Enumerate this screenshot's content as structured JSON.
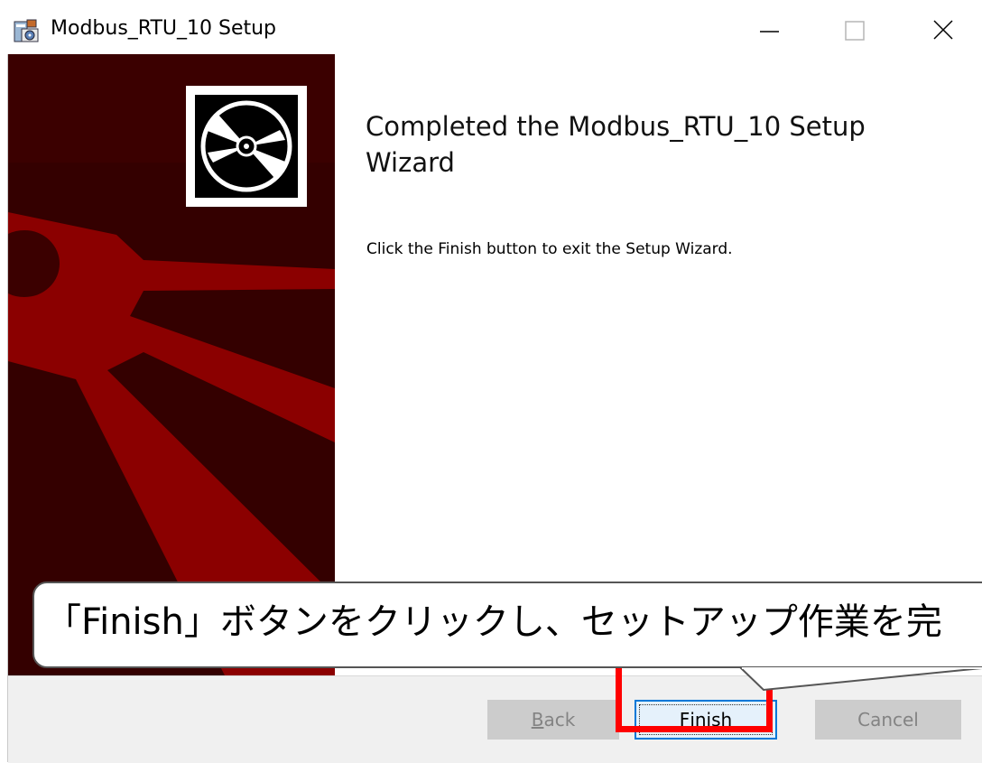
{
  "window": {
    "title": "Modbus_RTU_10 Setup",
    "controls": {
      "minimize": "minimize-icon",
      "maximize": "maximize-icon",
      "close": "close-icon"
    }
  },
  "banner": {
    "icon": "disc-icon",
    "colors": {
      "dark": "#3b0000",
      "red": "#8b0000"
    }
  },
  "content": {
    "heading": "Completed the Modbus_RTU_10 Setup Wizard",
    "body": "Click the Finish button to exit the Setup Wizard."
  },
  "footer": {
    "back": {
      "mnemonic": "B",
      "rest": "ack",
      "enabled": false
    },
    "finish": {
      "mnemonic": "F",
      "rest": "inish",
      "enabled": true
    },
    "cancel": {
      "label": "Cancel",
      "enabled": false
    }
  },
  "annotation": {
    "callout_text": "「Finish」ボタンをクリックし、セットアップ作業を完",
    "highlight_color": "#ff0000"
  }
}
